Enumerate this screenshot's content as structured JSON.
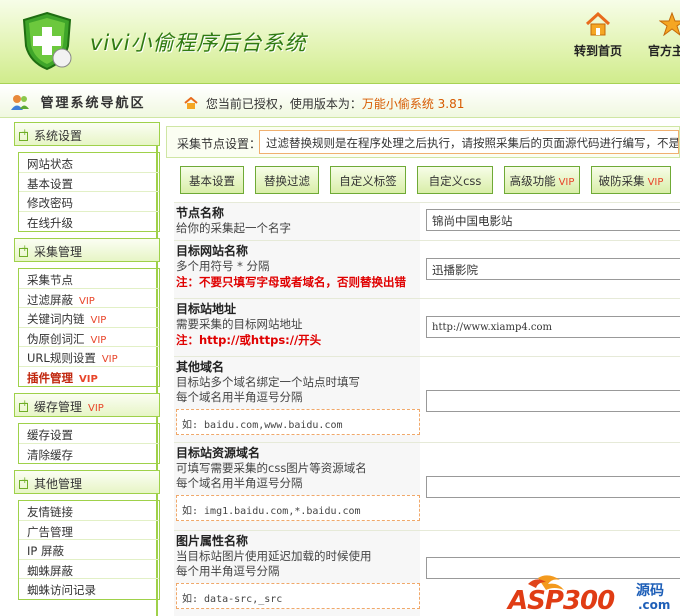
{
  "header": {
    "title": "vivi小偷程序后台系统",
    "links": [
      {
        "label": "转到首页",
        "icon": "home-icon"
      },
      {
        "label": "官方主页",
        "icon": "star-icon"
      }
    ]
  },
  "sidebar": {
    "title": "管理系统导航区",
    "groups": [
      {
        "label": "系统设置",
        "items": [
          {
            "label": "网站状态"
          },
          {
            "label": "基本设置"
          },
          {
            "label": "修改密码"
          },
          {
            "label": "在线升级"
          }
        ]
      },
      {
        "label": "采集管理",
        "items": [
          {
            "label": "采集节点",
            "vip": ""
          },
          {
            "label": "过滤屏蔽",
            "vip": "VIP"
          },
          {
            "label": "关键词内链",
            "vip": "VIP"
          },
          {
            "label": "伪原创词汇",
            "vip": "VIP"
          },
          {
            "label": "URL规则设置",
            "vip": "VIP"
          },
          {
            "label": "插件管理",
            "vip": "VIP"
          }
        ]
      },
      {
        "label": "缓存管理",
        "vip": "VIP",
        "items": [
          {
            "label": "缓存设置"
          },
          {
            "label": "清除缓存"
          }
        ]
      },
      {
        "label": "其他管理",
        "items": [
          {
            "label": "友情链接"
          },
          {
            "label": "广告管理"
          },
          {
            "label": "IP 屏蔽"
          },
          {
            "label": "蜘蛛屏蔽"
          },
          {
            "label": "蜘蛛访问记录"
          }
        ]
      }
    ]
  },
  "breadcrumb": {
    "prefix": "您当前已授权，使用版本为：",
    "version": "万能小偷系统 3.81"
  },
  "notice": {
    "label": "采集节点设置：",
    "text": "过滤替换规则是在程序处理之后执行，请按照采集后的页面源代码进行编写，不是"
  },
  "tabs": [
    {
      "label": "基本设置",
      "vip": ""
    },
    {
      "label": "替换过滤",
      "vip": ""
    },
    {
      "label": "自定义标签",
      "vip": ""
    },
    {
      "label": "自定义css",
      "vip": ""
    },
    {
      "label": "高级功能",
      "vip": "VIP"
    },
    {
      "label": "破防采集",
      "vip": "VIP"
    }
  ],
  "form": {
    "node_name": {
      "title": "节点名称",
      "desc": "给你的采集起一个名字",
      "value": "锦尚中国电影站"
    },
    "target_name": {
      "title": "目标网站名称",
      "desc": "多个用符号 * 分隔",
      "warn": "注：不要只填写字母或者域名，否则替换出错",
      "value": "迅播影院"
    },
    "target_url": {
      "title": "目标站地址",
      "desc": "需要采集的目标网站地址",
      "warn": "注：http://或https://开头",
      "value": "http://www.xiamp4.com"
    },
    "other_domains": {
      "title": "其他域名",
      "desc1": "目标站多个域名绑定一个站点时填写",
      "desc2": "每个域名用半角逗号分隔",
      "example": "如: baidu.com,www.baidu.com",
      "value": ""
    },
    "resource_domains": {
      "title": "目标站资源域名",
      "desc1": "可填写需要采集的css图片等资源域名",
      "desc2": "每个域名用半角逗号分隔",
      "example": "如: img1.baidu.com,*.baidu.com",
      "value": ""
    },
    "image_attr": {
      "title": "图片属性名称",
      "desc1": "当目标站图片使用延迟加载的时候使用",
      "desc2": "每个用半角逗号分隔",
      "example": "如: data-src,_src",
      "value": ""
    }
  },
  "watermark": {
    "text": "ASP300",
    "sub": "源码",
    "url": ".com"
  }
}
